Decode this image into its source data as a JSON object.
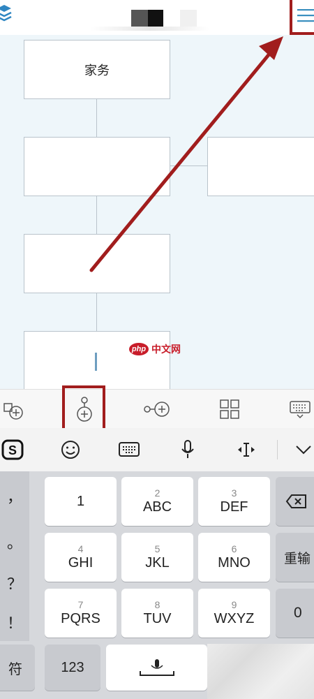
{
  "topbar": {
    "menu_icon": "hamburger-menu-icon",
    "layers_icon": "layers-icon"
  },
  "canvas": {
    "root_node_label": "家务",
    "watermark_badge": "php",
    "watermark_text": "中文网"
  },
  "node_toolbar": {
    "tools": [
      "add-sibling-icon",
      "add-child-icon",
      "add-link-node-icon",
      "layout-grid-icon",
      "keyboard-icon"
    ]
  },
  "ime_toolbar": {
    "tools": [
      "sogou-logo-icon",
      "emoji-icon",
      "keyboard-icon",
      "microphone-icon",
      "cursor-move-icon",
      "collapse-icon"
    ]
  },
  "keyboard": {
    "punctuation": [
      "，",
      "。",
      "？",
      "！"
    ],
    "keys": [
      {
        "num": "",
        "letters": "1"
      },
      {
        "num": "2",
        "letters": "ABC"
      },
      {
        "num": "3",
        "letters": "DEF"
      },
      {
        "num": "4",
        "letters": "GHI"
      },
      {
        "num": "5",
        "letters": "JKL"
      },
      {
        "num": "6",
        "letters": "MNO"
      },
      {
        "num": "7",
        "letters": "PQRS"
      },
      {
        "num": "8",
        "letters": "TUV"
      },
      {
        "num": "9",
        "letters": "WXYZ"
      }
    ],
    "reenter_label": "重输",
    "zero_label": "0",
    "symbols_label": "符",
    "numbers_label": "123"
  },
  "colors": {
    "annotation": "#a11d1d",
    "canvas_bg": "#eef6fa",
    "accent": "#3a8fbf"
  }
}
